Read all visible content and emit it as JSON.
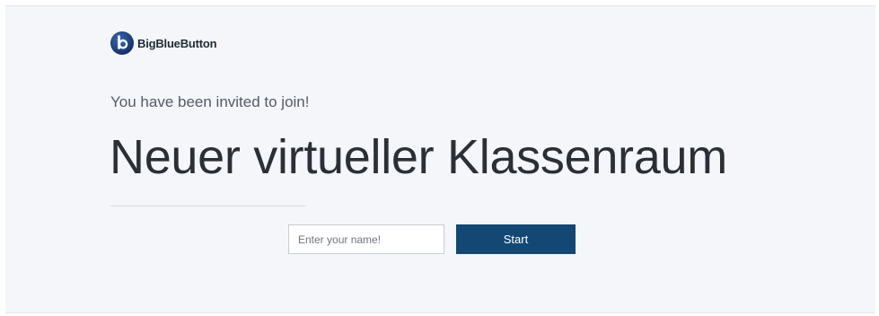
{
  "brand": {
    "name": "BigBlueButton",
    "icon": "bigbluebutton-logo-icon",
    "color": "#1b3f7a"
  },
  "invitation": {
    "message": "You have been invited to join!",
    "room_name": "Neuer virtueller Klassenraum"
  },
  "join_form": {
    "name_placeholder": "Enter your name!",
    "name_value": "",
    "start_label": "Start",
    "button_color": "#134774"
  }
}
